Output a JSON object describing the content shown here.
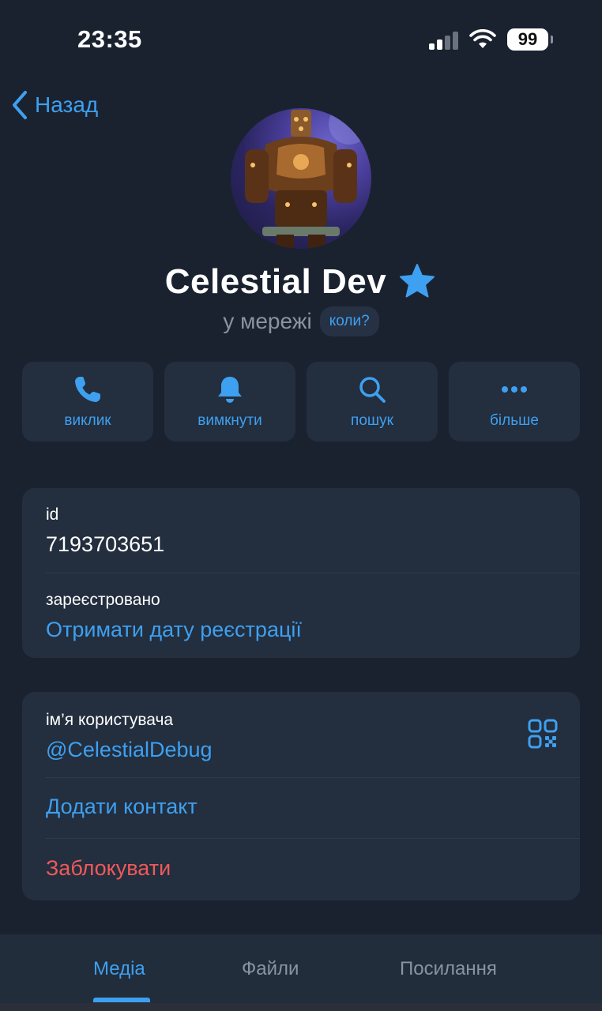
{
  "status_bar": {
    "time": "23:35",
    "battery": "99"
  },
  "nav": {
    "back_label": "Назад"
  },
  "profile": {
    "name": "Celestial Dev",
    "status": "у мережі",
    "when_label": "коли?"
  },
  "actions": [
    {
      "label": "виклик",
      "icon": "phone-icon"
    },
    {
      "label": "вимкнути",
      "icon": "bell-icon"
    },
    {
      "label": "пошук",
      "icon": "search-icon"
    },
    {
      "label": "більше",
      "icon": "more-icon"
    }
  ],
  "info": {
    "id_label": "id",
    "id_value": "7193703651",
    "registered_label": "зареєстровано",
    "registered_value": "Отримати дату реєстрації"
  },
  "contact": {
    "username_label": "ім’я користувача",
    "username_value": "@CelestialDebug",
    "add_contact": "Додати контакт",
    "block": "Заблокувати"
  },
  "tabs": [
    {
      "label": "Медіа",
      "active": true
    },
    {
      "label": "Файли",
      "active": false
    },
    {
      "label": "Посилання",
      "active": false
    }
  ],
  "colors": {
    "accent": "#3ea0f0",
    "danger": "#ef5a5a",
    "background": "#1a2230",
    "card": "#232e3e"
  }
}
